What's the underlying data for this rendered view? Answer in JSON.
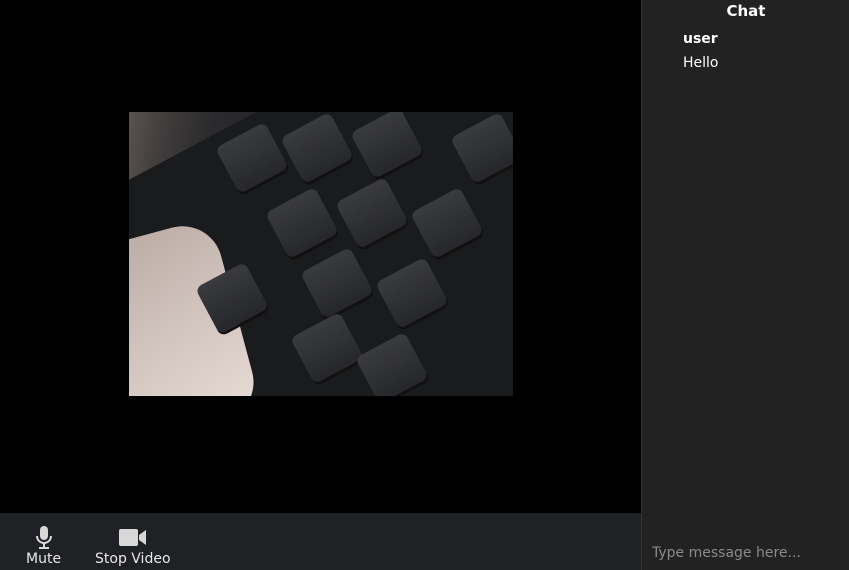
{
  "toolbar": {
    "mute_label": "Mute",
    "mute_icon": "microphone-icon",
    "video_label": "Stop Video",
    "video_icon": "video-camera-icon"
  },
  "chat": {
    "title": "Chat",
    "messages": [
      {
        "user": "user",
        "text": "Hello"
      }
    ],
    "input_placeholder": "Type message here..."
  },
  "colors": {
    "toolbar_bg": "#202124",
    "chat_bg": "#222222",
    "icon": "#d8d8d8"
  }
}
